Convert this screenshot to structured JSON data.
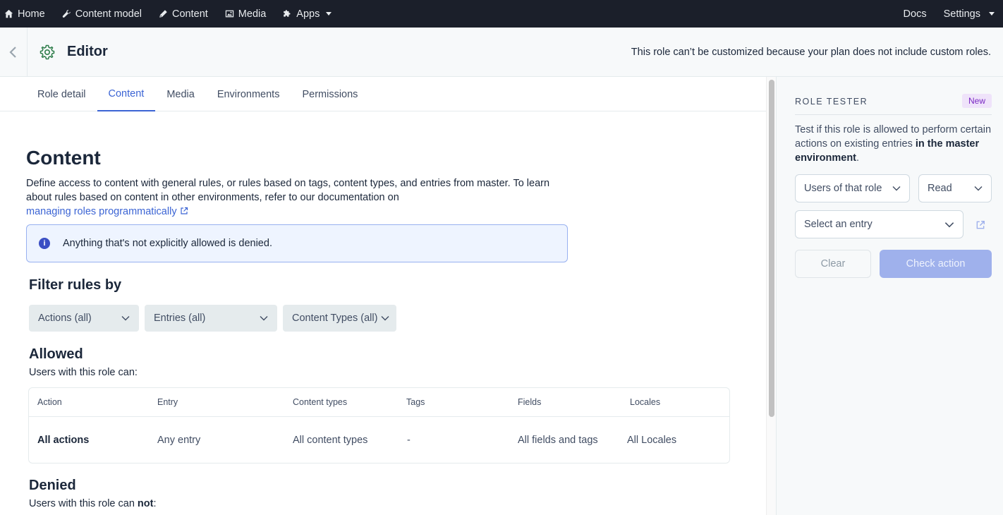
{
  "topnav": {
    "items": [
      {
        "label": "Home",
        "icon": "home-icon"
      },
      {
        "label": "Content model",
        "icon": "wrench-icon"
      },
      {
        "label": "Content",
        "icon": "pen-icon"
      },
      {
        "label": "Media",
        "icon": "image-icon"
      },
      {
        "label": "Apps",
        "icon": "puzzle-icon"
      }
    ],
    "docs": "Docs",
    "settings": "Settings"
  },
  "header": {
    "title": "Editor",
    "note": "This role can’t be customized because your plan does not include custom roles."
  },
  "tabs": [
    "Role detail",
    "Content",
    "Media",
    "Environments",
    "Permissions"
  ],
  "active_tab": "Content",
  "main": {
    "heading": "Content",
    "description": "Define access to content with general rules, or rules based on tags, content types, and entries from master. To learn about rules based on content in other environments, refer to our documentation on",
    "doc_link": "managing roles programmatically",
    "note": "Anything that's not explicitly allowed is denied.",
    "filter_heading": "Filter rules by",
    "filters": [
      "Actions (all)",
      "Entries (all)",
      "Content Types (all)"
    ],
    "allowed_heading": "Allowed",
    "allowed_sub": "Users with this role can:",
    "table_headers": [
      "Action",
      "Entry",
      "Content types",
      "Tags",
      "Fields",
      "Locales"
    ],
    "table_rows": [
      [
        "All actions",
        "Any entry",
        "All content types",
        "-",
        "All fields and tags",
        "All Locales"
      ]
    ],
    "denied_heading": "Denied",
    "denied_sub_prefix": "Users with this role can ",
    "denied_sub_bold": "not",
    "denied_sub_suffix": ":"
  },
  "tester": {
    "title": "ROLE TESTER",
    "badge": "New",
    "desc_prefix": "Test if this role is allowed to perform certain actions on existing entries ",
    "desc_bold": "in the master environment",
    "desc_suffix": ".",
    "user_select": "Users of that role",
    "action_select": "Read",
    "entry_select": "Select an entry",
    "clear_label": "Clear",
    "check_label": "Check action"
  },
  "colors": {
    "nav_bg": "#1b1f2a",
    "accent": "#3b64d4",
    "badge_bg": "#efe3fa",
    "badge_fg": "#7a29c4",
    "check_disabled": "#9fb1ec"
  }
}
